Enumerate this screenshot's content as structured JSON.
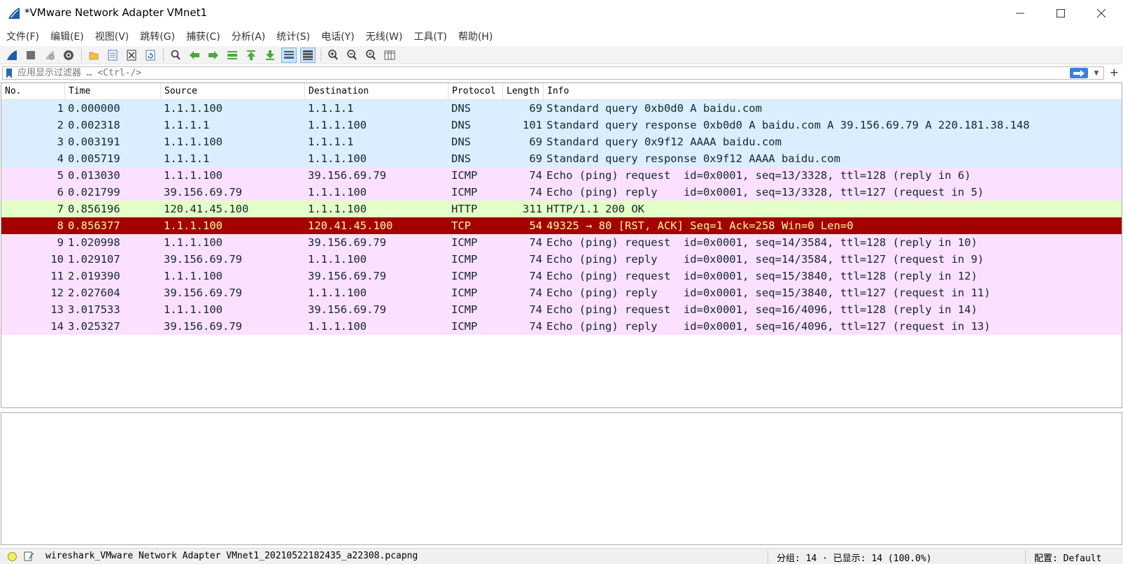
{
  "window": {
    "title": "*VMware Network Adapter VMnet1"
  },
  "menu": [
    {
      "label": "文件(F)"
    },
    {
      "label": "编辑(E)"
    },
    {
      "label": "视图(V)"
    },
    {
      "label": "跳转(G)"
    },
    {
      "label": "捕获(C)"
    },
    {
      "label": "分析(A)"
    },
    {
      "label": "统计(S)"
    },
    {
      "label": "电话(Y)"
    },
    {
      "label": "无线(W)"
    },
    {
      "label": "工具(T)"
    },
    {
      "label": "帮助(H)"
    }
  ],
  "toolbar": {
    "icons": [
      "start-capture-icon",
      "stop-capture-icon",
      "restart-capture-icon",
      "capture-options-icon",
      "open-file-icon",
      "save-file-icon",
      "close-file-icon",
      "reload-file-icon",
      "find-packet-icon",
      "go-back-icon",
      "go-forward-icon",
      "go-to-packet-icon",
      "first-packet-icon",
      "last-packet-icon",
      "autoscroll-icon",
      "colorize-icon",
      "zoom-in-icon",
      "zoom-out-icon",
      "zoom-normal-icon",
      "resize-columns-icon"
    ],
    "accent": "#3a82d9"
  },
  "filter": {
    "placeholder": "应用显示过滤器 … <Ctrl-/>",
    "value": ""
  },
  "packet_list": {
    "columns": [
      "No.",
      "Time",
      "Source",
      "Destination",
      "Protocol",
      "Length",
      "Info"
    ],
    "rows": [
      {
        "no": "1",
        "time": "0.000000",
        "src": "1.1.1.100",
        "dst": "1.1.1.1",
        "proto": "DNS",
        "len": "69",
        "info": "Standard query 0xb0d0 A baidu.com",
        "color": "dns"
      },
      {
        "no": "2",
        "time": "0.002318",
        "src": "1.1.1.1",
        "dst": "1.1.1.100",
        "proto": "DNS",
        "len": "101",
        "info": "Standard query response 0xb0d0 A baidu.com A 39.156.69.79 A 220.181.38.148",
        "color": "dns"
      },
      {
        "no": "3",
        "time": "0.003191",
        "src": "1.1.1.100",
        "dst": "1.1.1.1",
        "proto": "DNS",
        "len": "69",
        "info": "Standard query 0x9f12 AAAA baidu.com",
        "color": "dns"
      },
      {
        "no": "4",
        "time": "0.005719",
        "src": "1.1.1.1",
        "dst": "1.1.1.100",
        "proto": "DNS",
        "len": "69",
        "info": "Standard query response 0x9f12 AAAA baidu.com",
        "color": "dns"
      },
      {
        "no": "5",
        "time": "0.013030",
        "src": "1.1.1.100",
        "dst": "39.156.69.79",
        "proto": "ICMP",
        "len": "74",
        "info": "Echo (ping) request  id=0x0001, seq=13/3328, ttl=128 (reply in 6)",
        "color": "icmp"
      },
      {
        "no": "6",
        "time": "0.021799",
        "src": "39.156.69.79",
        "dst": "1.1.1.100",
        "proto": "ICMP",
        "len": "74",
        "info": "Echo (ping) reply    id=0x0001, seq=13/3328, ttl=127 (request in 5)",
        "color": "icmp"
      },
      {
        "no": "7",
        "time": "0.856196",
        "src": "120.41.45.100",
        "dst": "1.1.1.100",
        "proto": "HTTP",
        "len": "311",
        "info": "HTTP/1.1 200 OK",
        "color": "http"
      },
      {
        "no": "8",
        "time": "0.856377",
        "src": "1.1.1.100",
        "dst": "120.41.45.100",
        "proto": "TCP",
        "len": "54",
        "info": "49325 → 80 [RST, ACK] Seq=1 Ack=258 Win=0 Len=0",
        "color": "tcprst"
      },
      {
        "no": "9",
        "time": "1.020998",
        "src": "1.1.1.100",
        "dst": "39.156.69.79",
        "proto": "ICMP",
        "len": "74",
        "info": "Echo (ping) request  id=0x0001, seq=14/3584, ttl=128 (reply in 10)",
        "color": "icmp"
      },
      {
        "no": "10",
        "time": "1.029107",
        "src": "39.156.69.79",
        "dst": "1.1.1.100",
        "proto": "ICMP",
        "len": "74",
        "info": "Echo (ping) reply    id=0x0001, seq=14/3584, ttl=127 (request in 9)",
        "color": "icmp"
      },
      {
        "no": "11",
        "time": "2.019390",
        "src": "1.1.1.100",
        "dst": "39.156.69.79",
        "proto": "ICMP",
        "len": "74",
        "info": "Echo (ping) request  id=0x0001, seq=15/3840, ttl=128 (reply in 12)",
        "color": "icmp"
      },
      {
        "no": "12",
        "time": "2.027604",
        "src": "39.156.69.79",
        "dst": "1.1.1.100",
        "proto": "ICMP",
        "len": "74",
        "info": "Echo (ping) reply    id=0x0001, seq=15/3840, ttl=127 (request in 11)",
        "color": "icmp"
      },
      {
        "no": "13",
        "time": "3.017533",
        "src": "1.1.1.100",
        "dst": "39.156.69.79",
        "proto": "ICMP",
        "len": "74",
        "info": "Echo (ping) request  id=0x0001, seq=16/4096, ttl=128 (reply in 14)",
        "color": "icmp"
      },
      {
        "no": "14",
        "time": "3.025327",
        "src": "39.156.69.79",
        "dst": "1.1.1.100",
        "proto": "ICMP",
        "len": "74",
        "info": "Echo (ping) reply    id=0x0001, seq=16/4096, ttl=127 (request in 13)",
        "color": "icmp"
      }
    ],
    "row_colors": {
      "dns": "#daeeff",
      "icmp": "#fce0ff",
      "http": "#e4ffc7",
      "tcprst": "#a40000"
    }
  },
  "status": {
    "file": "wireshark_VMware Network Adapter VMnet1_20210522182435_a22308.pcapng",
    "packets": "分组: 14 · 已显示: 14 (100.0%)",
    "profile": "配置: Default"
  }
}
